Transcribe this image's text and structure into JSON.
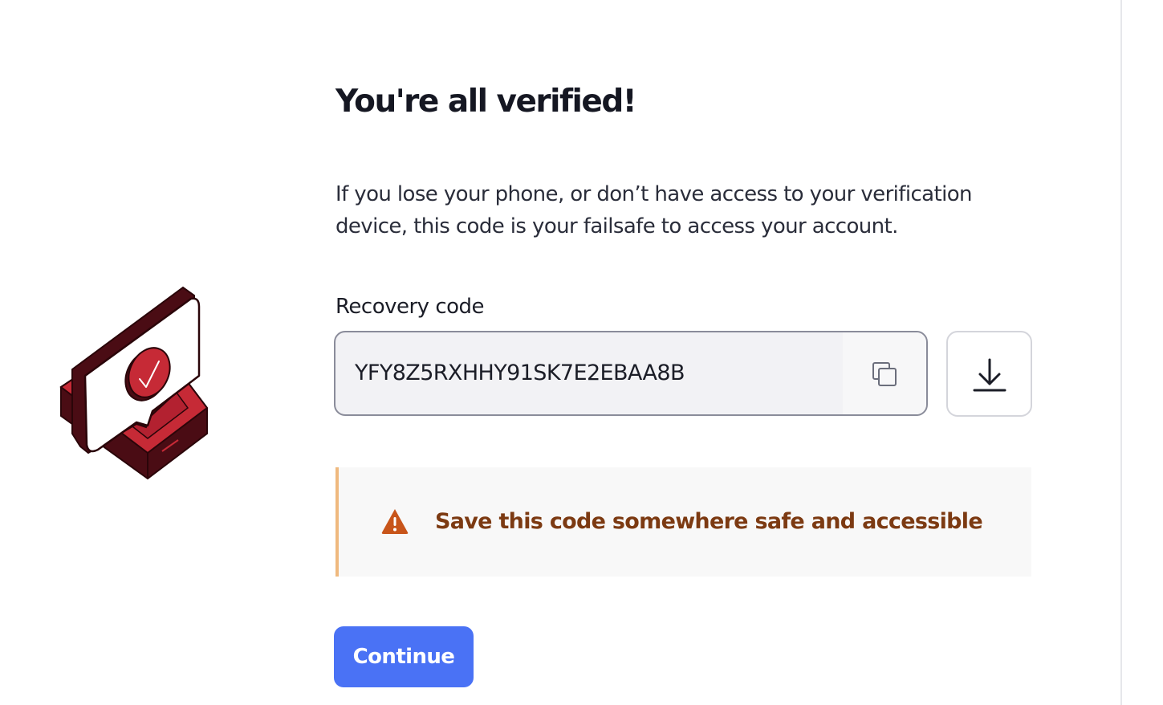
{
  "header": {
    "title": "You're all verified!"
  },
  "main": {
    "description": "If you lose your phone, or don’t have access to your verification device, this code is your failsafe to access your account.",
    "recovery": {
      "label": "Recovery code",
      "code": "YFY8Z5RXHHY91SK7E2EBAA8B",
      "copy_icon": "copy-icon",
      "download_icon": "download-icon"
    },
    "warning": {
      "icon": "warning-icon",
      "text": "Save this code somewhere safe and accessible"
    },
    "continue_label": "Continue"
  },
  "colors": {
    "primary": "#4a72f5",
    "warning_text": "#7c3a12",
    "warning_accent": "#efb97e",
    "warning_icon": "#c8551a",
    "illustration_red": "#c62a36",
    "illustration_dark": "#4a0c14"
  }
}
